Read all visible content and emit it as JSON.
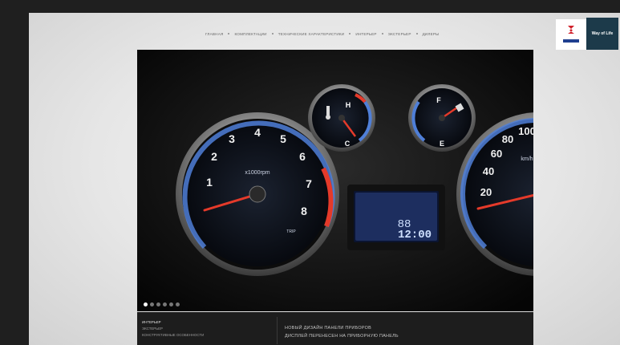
{
  "nav": {
    "items": [
      "ГЛАВНАЯ",
      "КОМПЛЕКТАЦИИ",
      "ТЕХНИЧЕСКИЕ ХАРАКТЕРИСТИКИ",
      "ИНТЕРЬЕР",
      "ЭКСТЕРЬЕР",
      "ДИЛЕРЫ"
    ]
  },
  "brand": {
    "logo_text": "SUZUKI",
    "badge_text": "Way of Life"
  },
  "gauges": {
    "tach_numbers": [
      "1",
      "2",
      "3",
      "4",
      "5",
      "6",
      "7",
      "8"
    ],
    "tach_unit": "x1000rpm",
    "tach_sub": "TRIP",
    "speed_numbers": [
      "20",
      "40",
      "60",
      "80",
      "100"
    ],
    "speed_unit": "km/h",
    "temp_high": "H",
    "temp_low": "C",
    "fuel_full": "F",
    "fuel_empty": "E",
    "display_top": "88",
    "display_bottom": "12:00"
  },
  "slider": {
    "dot_count": 6,
    "active_index": 0
  },
  "caption": {
    "menu": [
      "ИНТЕРЬЕР",
      "ЭКСТЕРЬЕР",
      "КОНСТРУКТИВНЫЕ ОСОБЕННОСТИ"
    ],
    "line1": "НОВЫЙ ДИЗАЙН ПАНЕЛИ ПРИБОРОВ",
    "line2": "ДИСПЛЕЙ ПЕРЕНЕСЕН НА ПРИБОРНУЮ ПАНЕЛЬ"
  },
  "colors": {
    "accent": "#c8281e",
    "gauge_blue": "#4f7fd8",
    "needle": "#e53a2a",
    "lcd": "#6f8fe0"
  }
}
